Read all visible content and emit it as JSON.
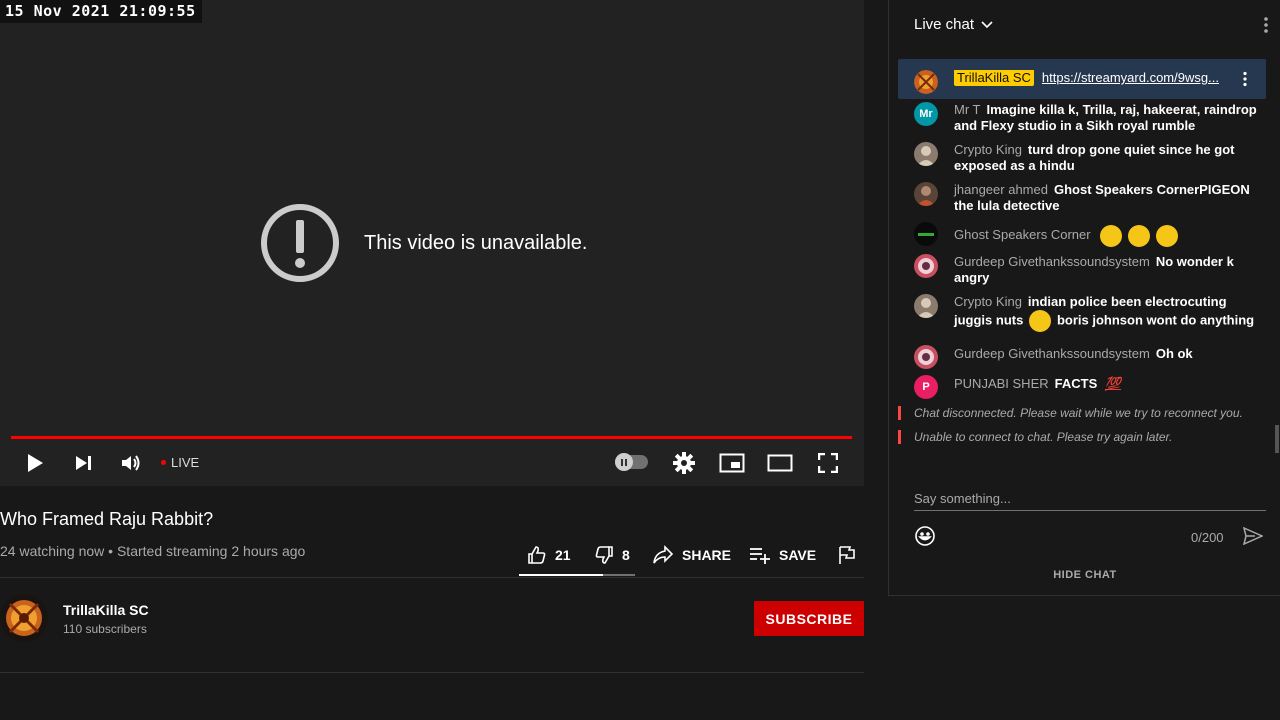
{
  "player": {
    "timestamp": "15 Nov 2021 21:09:55",
    "unavailable_text": "This video is unavailable.",
    "live_label": "LIVE",
    "icons": [
      "play-icon",
      "next-icon",
      "volume-icon",
      "settings-icon",
      "miniplayer-icon",
      "theater-icon",
      "fullscreen-icon",
      "error-icon"
    ]
  },
  "video": {
    "title": "Who Framed Raju Rabbit?",
    "meta": "24 watching now • Started streaming 2 hours ago",
    "likes": "21",
    "dislikes": "8",
    "like_fraction": 0.72,
    "share_label": "SHARE",
    "save_label": "SAVE"
  },
  "channel": {
    "name": "TrillaKilla SC",
    "subscribers": "110 subscribers",
    "subscribe_label": "SUBSCRIBE"
  },
  "chat": {
    "title": "Live chat",
    "pinned": {
      "author": "TrillaKilla SC",
      "link": "https://streamyard.com/9wsg..."
    },
    "messages": [
      {
        "author": "Mr T",
        "avatar": "Mr",
        "avatar_color": "#0097a7",
        "text": "Imagine killa k, Trilla, raj, hakeerat, raindrop and Flexy studio in a Sikh royal rumble"
      },
      {
        "author": "Crypto King",
        "text": "turd drop gone quiet since he got exposed as a hindu"
      },
      {
        "author": "jhangeer ahmed",
        "text": "Ghost Speakers CornerPIGEON the lula detective"
      },
      {
        "author": "Ghost Speakers Corner",
        "text": ""
      },
      {
        "author": "Gurdeep Givethankssoundsystem",
        "text": "No wonder k angry"
      },
      {
        "author": "Crypto King",
        "text_before": "indian police been electrocuting juggis nuts",
        "text_after": "boris johnson wont do anything"
      },
      {
        "author": "Gurdeep Givethankssoundsystem",
        "text": "Oh ok"
      },
      {
        "author": "PUNJABI SHER",
        "avatar": "P",
        "avatar_color": "#e91e63",
        "text": "FACTS"
      }
    ],
    "system_messages": [
      "Chat disconnected. Please wait while we try to reconnect you.",
      "Unable to connect to chat. Please try again later."
    ],
    "input_placeholder": "Say something...",
    "counter": "0/200",
    "hide_label": "HIDE CHAT"
  }
}
